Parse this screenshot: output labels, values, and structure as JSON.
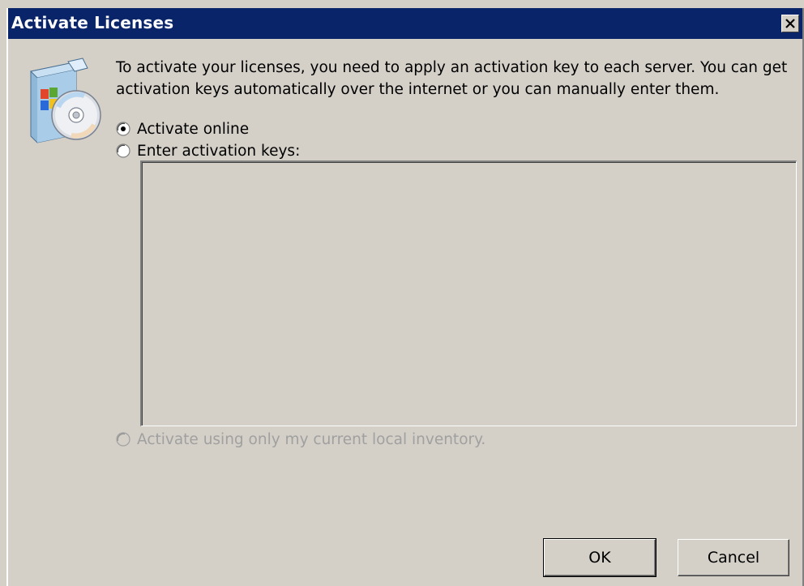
{
  "window": {
    "title": "Activate Licenses"
  },
  "intro_text": "To activate your licenses, you need to apply an activation key to each server. You can get activation keys automatically over the internet or you can manually enter them.",
  "options": [
    {
      "label": "Activate online",
      "selected": true,
      "enabled": true
    },
    {
      "label": "Enter activation keys:",
      "selected": false,
      "enabled": true
    },
    {
      "label": "Activate using only my current local inventory.",
      "selected": false,
      "enabled": false
    }
  ],
  "activation_keys_value": "",
  "buttons": {
    "ok_label": "OK",
    "cancel_label": "Cancel"
  },
  "icons": {
    "app": "software-package-cd-icon",
    "close": "close-icon"
  },
  "colors": {
    "titlebar": "#0a246a",
    "face": "#d4d0c8",
    "disabled_text": "#a0a0a0"
  }
}
